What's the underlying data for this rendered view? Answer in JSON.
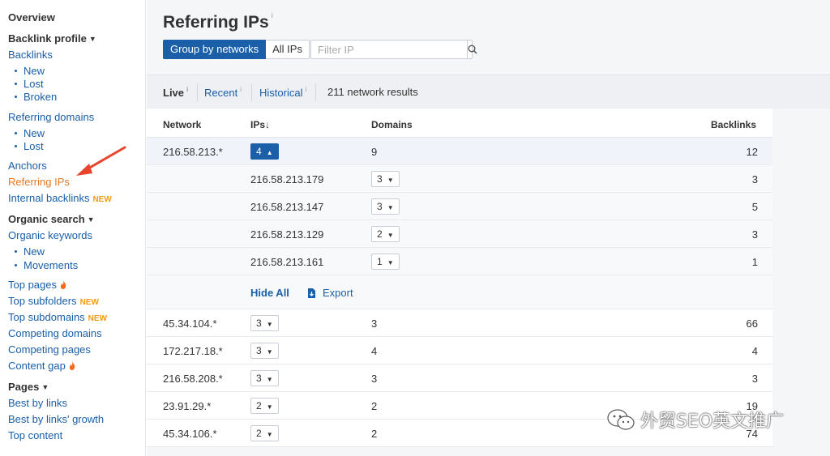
{
  "sidebar": {
    "overview": "Overview",
    "backlink_profile": "Backlink profile",
    "backlinks": "Backlinks",
    "backlinks_sub": [
      "New",
      "Lost",
      "Broken"
    ],
    "referring_domains": "Referring domains",
    "referring_domains_sub": [
      "New",
      "Lost"
    ],
    "anchors": "Anchors",
    "referring_ips": "Referring IPs",
    "internal_backlinks": "Internal backlinks",
    "new_badge": "NEW",
    "organic_search": "Organic search",
    "organic_keywords": "Organic keywords",
    "organic_sub": [
      "New",
      "Movements"
    ],
    "top_pages": "Top pages",
    "top_subfolders": "Top subfolders",
    "top_subdomains": "Top subdomains",
    "competing_domains": "Competing domains",
    "competing_pages": "Competing pages",
    "content_gap": "Content gap",
    "pages": "Pages",
    "best_by_links": "Best by links",
    "best_by_links_growth": "Best by links' growth",
    "top_content": "Top content"
  },
  "header": {
    "title": "Referring IPs",
    "info": "i",
    "group_by_networks": "Group by networks",
    "all_ips": "All IPs",
    "filter_placeholder": "Filter IP"
  },
  "tabs": {
    "live": "Live",
    "recent": "Recent",
    "historical": "Historical",
    "info": "i",
    "results": "211 network results"
  },
  "table": {
    "columns": {
      "network": "Network",
      "ips": "IPs",
      "sort_arrow": "↓",
      "domains": "Domains",
      "backlinks": "Backlinks"
    },
    "expanded": {
      "network": "216.58.213.*",
      "ips": "4",
      "domains": "9",
      "backlinks": "12",
      "children": [
        {
          "ip": "216.58.213.179",
          "domains": "3",
          "backlinks": "3"
        },
        {
          "ip": "216.58.213.147",
          "domains": "3",
          "backlinks": "5"
        },
        {
          "ip": "216.58.213.129",
          "domains": "2",
          "backlinks": "3"
        },
        {
          "ip": "216.58.213.161",
          "domains": "1",
          "backlinks": "1"
        }
      ],
      "hide_all": "Hide All",
      "export": "Export"
    },
    "rows": [
      {
        "network": "45.34.104.*",
        "ips": "3",
        "domains": "3",
        "backlinks": "66"
      },
      {
        "network": "172.217.18.*",
        "ips": "3",
        "domains": "4",
        "backlinks": "4"
      },
      {
        "network": "216.58.208.*",
        "ips": "3",
        "domains": "3",
        "backlinks": "3"
      },
      {
        "network": "23.91.29.*",
        "ips": "2",
        "domains": "2",
        "backlinks": "19"
      },
      {
        "network": "45.34.106.*",
        "ips": "2",
        "domains": "2",
        "backlinks": "74"
      }
    ]
  },
  "watermark": {
    "text": "外贸SEO英文推广"
  },
  "colors": {
    "accent": "#1a5fa8",
    "active_link": "#e87722",
    "new_badge": "#f29c11",
    "annotation_arrow": "#e8442e"
  },
  "icons": {
    "fire": "fire-icon",
    "search": "search-icon",
    "export": "export-icon",
    "caret": "caret-down-icon"
  }
}
